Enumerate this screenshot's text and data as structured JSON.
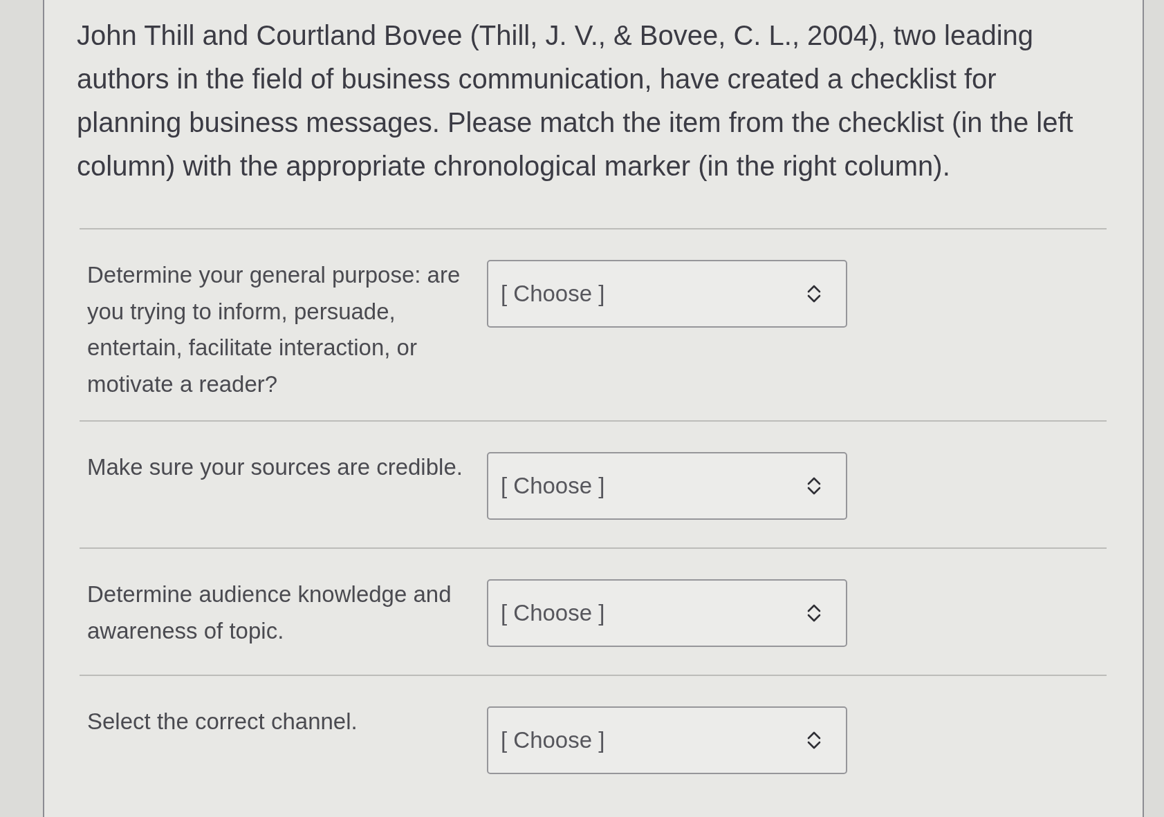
{
  "intro": "John Thill and Courtland Bovee (Thill, J. V., & Bovee, C. L., 2004), two leading authors in the field of business communication, have created a checklist for planning business messages. Please match the item from the checklist (in the left column) with the appropriate chronological marker (in the right column).",
  "items": [
    {
      "prompt": "Determine your general purpose: are you trying to inform, persuade, entertain, facilitate interaction, or motivate a reader?",
      "select": {
        "value": "[ Choose ]"
      }
    },
    {
      "prompt": "Make sure your sources are credible.",
      "select": {
        "value": "[ Choose ]"
      }
    },
    {
      "prompt": "Determine audience knowledge and awareness of topic.",
      "select": {
        "value": "[ Choose ]"
      }
    },
    {
      "prompt": "Select the correct channel.",
      "select": {
        "value": "[ Choose ]"
      }
    }
  ]
}
